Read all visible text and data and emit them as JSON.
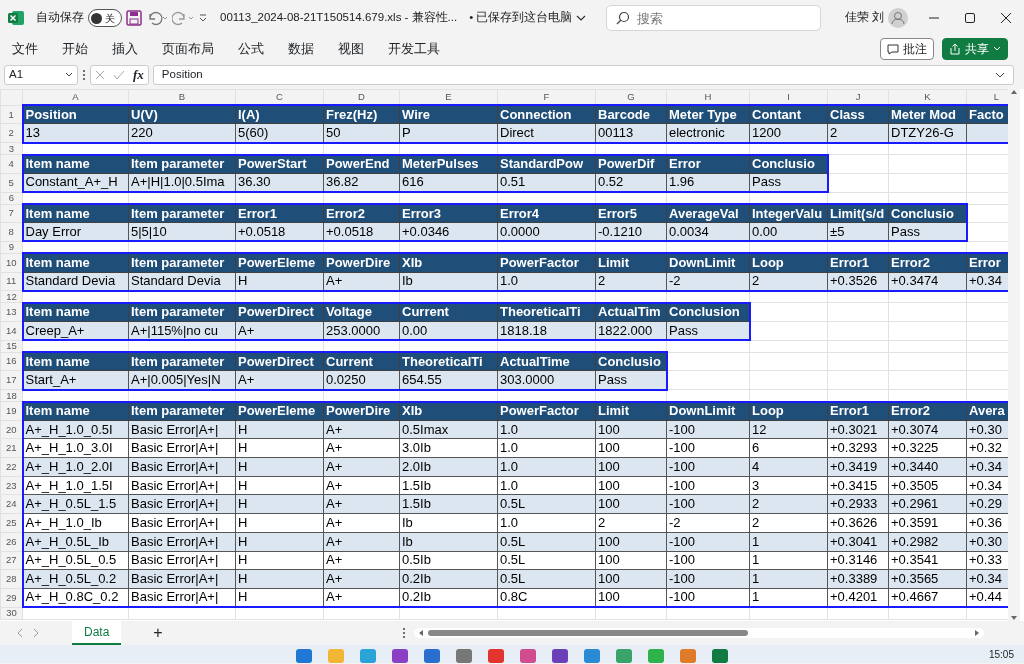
{
  "window": {
    "title": "00113_2024-08-21T150514.679.xls  -  兼容性...",
    "save_status": "• 已保存到这台电脑",
    "user": "佳荣 刘"
  },
  "autosave": {
    "label": "自动保存",
    "on": false,
    "state_text": "关"
  },
  "search": {
    "placeholder": "搜索"
  },
  "menu": [
    "文件",
    "开始",
    "插入",
    "页面布局",
    "公式",
    "数据",
    "视图",
    "开发工具"
  ],
  "ribbon_buttons": [
    {
      "label": "批注",
      "kind": "outline"
    },
    {
      "label": "共享",
      "kind": "primary"
    }
  ],
  "formula_bar": {
    "name_box": "A1",
    "fx": "fx",
    "value": "Position"
  },
  "columns": [
    "A",
    "B",
    "C",
    "D",
    "E",
    "F",
    "G",
    "H",
    "I",
    "J",
    "K",
    "L"
  ],
  "rows": [
    {
      "number": "1",
      "kind": "header",
      "cells": [
        "Position",
        "U(V)",
        "I(A)",
        "Frez(Hz)",
        "Wire",
        "Connection",
        "Barcode",
        "Meter Type",
        "Contant",
        "Class",
        "Meter Mod",
        "Facto"
      ]
    },
    {
      "number": "2",
      "kind": "data",
      "shaded": true,
      "cells": [
        "13",
        "220",
        "5(60)",
        "50",
        "P",
        "Direct",
        "00113",
        "electronic",
        "1200",
        "2",
        "DTZY26-G"
      ]
    },
    {
      "number": "3",
      "kind": "blank"
    },
    {
      "number": "4",
      "kind": "header",
      "cells": [
        "Item name",
        "Item parameter",
        "PowerStart",
        "PowerEnd",
        "MeterPulses",
        "StandardPow",
        "PowerDif",
        "Error",
        "Conclusio"
      ]
    },
    {
      "number": "5",
      "kind": "data",
      "shaded": true,
      "cells": [
        "Constant_A+_H",
        "A+|H|1.0|0.5Ima",
        "36.30",
        "36.82",
        "616",
        "0.51",
        "0.52",
        "1.96",
        "Pass"
      ]
    },
    {
      "number": "6",
      "kind": "blank"
    },
    {
      "number": "7",
      "kind": "header",
      "cells": [
        "Item name",
        "Item parameter",
        "Error1",
        "Error2",
        "Error3",
        "Error4",
        "Error5",
        "AverageVal",
        "IntegerValu",
        "Limit(s/d",
        "Conclusio"
      ]
    },
    {
      "number": "8",
      "kind": "data",
      "shaded": true,
      "cells": [
        "Day Error",
        "5|5|10",
        "+0.0518",
        "+0.0518",
        "+0.0346",
        "0.0000",
        "-0.1210",
        "0.0034",
        "0.00",
        "±5",
        "Pass"
      ]
    },
    {
      "number": "9",
      "kind": "blank"
    },
    {
      "number": "10",
      "kind": "header",
      "cells": [
        "Item name",
        "Item parameter",
        "PowerEleme",
        "PowerDire",
        "XIb",
        "PowerFactor",
        "Limit",
        "DownLimit",
        "Loop",
        "Error1",
        "Error2",
        "Error"
      ]
    },
    {
      "number": "11",
      "kind": "data",
      "shaded": true,
      "cells": [
        "Standard Devia",
        "Standard Devia",
        "H",
        "A+",
        "Ib",
        "1.0",
        "2",
        "-2",
        "2",
        "+0.3526",
        "+0.3474",
        "+0.34"
      ]
    },
    {
      "number": "12",
      "kind": "blank"
    },
    {
      "number": "13",
      "kind": "header",
      "cells": [
        "Item name",
        "Item parameter",
        "PowerDirect",
        "Voltage",
        "Current",
        "TheoreticalTi",
        "ActualTim",
        "Conclusion"
      ]
    },
    {
      "number": "14",
      "kind": "data",
      "shaded": true,
      "cells": [
        "Creep_A+",
        "A+|115%|no cu",
        "A+",
        "253.0000",
        "0.00",
        "1818.18",
        "1822.000",
        "Pass"
      ]
    },
    {
      "number": "15",
      "kind": "blank"
    },
    {
      "number": "16",
      "kind": "header",
      "cells": [
        "Item name",
        "Item parameter",
        "PowerDirect",
        "Current",
        "TheoreticalTi",
        "ActualTime",
        "Conclusio"
      ]
    },
    {
      "number": "17",
      "kind": "data",
      "shaded": true,
      "cells": [
        "Start_A+",
        "A+|0.005|Yes|N",
        "A+",
        "0.0250",
        "654.55",
        "303.0000",
        "Pass"
      ]
    },
    {
      "number": "18",
      "kind": "blank"
    },
    {
      "number": "19",
      "kind": "header",
      "cells": [
        "Item name",
        "Item parameter",
        "PowerEleme",
        "PowerDire",
        "XIb",
        "PowerFactor",
        "Limit",
        "DownLimit",
        "Loop",
        "Error1",
        "Error2",
        "Avera"
      ]
    },
    {
      "number": "20",
      "kind": "data",
      "shaded": true,
      "cells": [
        "A+_H_1.0_0.5I",
        "Basic Error|A+|",
        "H",
        "A+",
        "0.5Imax",
        "1.0",
        "100",
        "-100",
        "12",
        "+0.3021",
        "+0.3074",
        "+0.30"
      ]
    },
    {
      "number": "21",
      "kind": "data",
      "shaded": false,
      "cells": [
        "A+_H_1.0_3.0I",
        "Basic Error|A+|",
        "H",
        "A+",
        "3.0Ib",
        "1.0",
        "100",
        "-100",
        "6",
        "+0.3293",
        "+0.3225",
        "+0.32"
      ]
    },
    {
      "number": "22",
      "kind": "data",
      "shaded": true,
      "cells": [
        "A+_H_1.0_2.0I",
        "Basic Error|A+|",
        "H",
        "A+",
        "2.0Ib",
        "1.0",
        "100",
        "-100",
        "4",
        "+0.3419",
        "+0.3440",
        "+0.34"
      ]
    },
    {
      "number": "23",
      "kind": "data",
      "shaded": false,
      "cells": [
        "A+_H_1.0_1.5I",
        "Basic Error|A+|",
        "H",
        "A+",
        "1.5Ib",
        "1.0",
        "100",
        "-100",
        "3",
        "+0.3415",
        "+0.3505",
        "+0.34"
      ]
    },
    {
      "number": "24",
      "kind": "data",
      "shaded": true,
      "cells": [
        "A+_H_0.5L_1.5",
        "Basic Error|A+|",
        "H",
        "A+",
        "1.5Ib",
        "0.5L",
        "100",
        "-100",
        "2",
        "+0.2933",
        "+0.2961",
        "+0.29"
      ]
    },
    {
      "number": "25",
      "kind": "data",
      "shaded": false,
      "cells": [
        "A+_H_1.0_Ib",
        "Basic Error|A+|",
        "H",
        "A+",
        "Ib",
        "1.0",
        "2",
        "-2",
        "2",
        "+0.3626",
        "+0.3591",
        "+0.36"
      ]
    },
    {
      "number": "26",
      "kind": "data",
      "shaded": true,
      "cells": [
        "A+_H_0.5L_Ib",
        "Basic Error|A+|",
        "H",
        "A+",
        "Ib",
        "0.5L",
        "100",
        "-100",
        "1",
        "+0.3041",
        "+0.2982",
        "+0.30"
      ]
    },
    {
      "number": "27",
      "kind": "data",
      "shaded": false,
      "cells": [
        "A+_H_0.5L_0.5",
        "Basic Error|A+|",
        "H",
        "A+",
        "0.5Ib",
        "0.5L",
        "100",
        "-100",
        "1",
        "+0.3146",
        "+0.3541",
        "+0.33"
      ]
    },
    {
      "number": "28",
      "kind": "data",
      "shaded": true,
      "cells": [
        "A+_H_0.5L_0.2",
        "Basic Error|A+|",
        "H",
        "A+",
        "0.2Ib",
        "0.5L",
        "100",
        "-100",
        "1",
        "+0.3389",
        "+0.3565",
        "+0.34"
      ]
    },
    {
      "number": "29",
      "kind": "data",
      "shaded": false,
      "cells": [
        "A+_H_0.8C_0.2",
        "Basic Error|A+|",
        "H",
        "A+",
        "0.2Ib",
        "0.8C",
        "100",
        "-100",
        "1",
        "+0.4201",
        "+0.4667",
        "+0.44"
      ]
    },
    {
      "number": "30",
      "kind": "blank"
    }
  ],
  "sheet_tabs": [
    {
      "label": "Data",
      "selected": true
    }
  ],
  "add_sheet": "+",
  "taskbar": {
    "time": "15:05"
  }
}
